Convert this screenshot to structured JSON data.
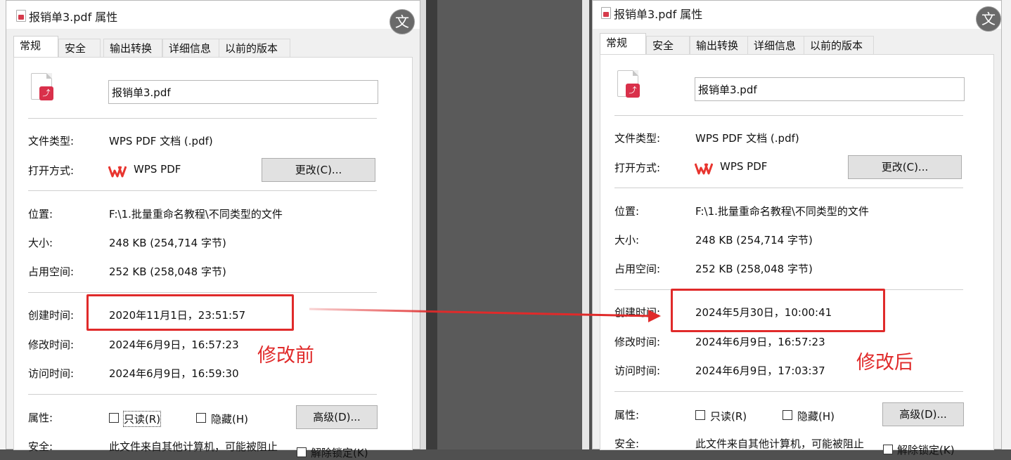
{
  "left": {
    "title": "报销单3.pdf 属性",
    "tabs": [
      "常规",
      "安全",
      "输出转换",
      "详细信息",
      "以前的版本"
    ],
    "filename": "报销单3.pdf",
    "type_label": "文件类型:",
    "type_value": "WPS PDF 文档 (.pdf)",
    "open_label": "打开方式:",
    "open_value": "WPS PDF",
    "change_btn": "更改(C)...",
    "location_label": "位置:",
    "location_value": "F:\\1.批量重命名教程\\不同类型的文件",
    "size_label": "大小:",
    "size_value": "248 KB (254,714 字节)",
    "disk_label": "占用空间:",
    "disk_value": "252 KB (258,048 字节)",
    "created_label": "创建时间:",
    "created_value": "2020年11月1日，23:51:57",
    "modified_label": "修改时间:",
    "modified_value": "2024年6月9日，16:57:23",
    "accessed_label": "访问时间:",
    "accessed_value": "2024年6月9日，16:59:30",
    "attr_label": "属性:",
    "readonly": "只读(R)",
    "hidden": "隐藏(H)",
    "advanced_btn": "高级(D)...",
    "security_label": "安全:",
    "security_text": "此文件来自其他计算机，可能被阻止",
    "unblock": "解除锁定(K)",
    "annotation": "修改前"
  },
  "right": {
    "title": "报销单3.pdf 属性",
    "tabs": [
      "常规",
      "安全",
      "输出转换",
      "详细信息",
      "以前的版本"
    ],
    "filename": "报销单3.pdf",
    "type_label": "文件类型:",
    "type_value": "WPS PDF 文档 (.pdf)",
    "open_label": "打开方式:",
    "open_value": "WPS PDF",
    "change_btn": "更改(C)...",
    "location_label": "位置:",
    "location_value": "F:\\1.批量重命名教程\\不同类型的文件",
    "size_label": "大小:",
    "size_value": "248 KB (254,714 字节)",
    "disk_label": "占用空间:",
    "disk_value": "252 KB (258,048 字节)",
    "created_label": "创建时间:",
    "created_value": "2024年5月30日，10:00:41",
    "modified_label": "修改时间:",
    "modified_value": "2024年6月9日，16:57:23",
    "accessed_label": "访问时间:",
    "accessed_value": "2024年6月9日，17:03:37",
    "attr_label": "属性:",
    "readonly": "只读(R)",
    "hidden": "隐藏(H)",
    "advanced_btn": "高级(D)...",
    "security_label": "安全:",
    "security_text": "此文件来自其他计算机，可能被阻止",
    "unblock": "解除锁定(K)",
    "annotation": "修改后"
  },
  "colors": {
    "annotation": "#e02a2a",
    "pdf_badge": "#d9304a",
    "wps": "#e8352f"
  },
  "icons": {
    "file": "pdf-file-icon",
    "app": "wps-logo-icon",
    "close": "close-icon"
  }
}
